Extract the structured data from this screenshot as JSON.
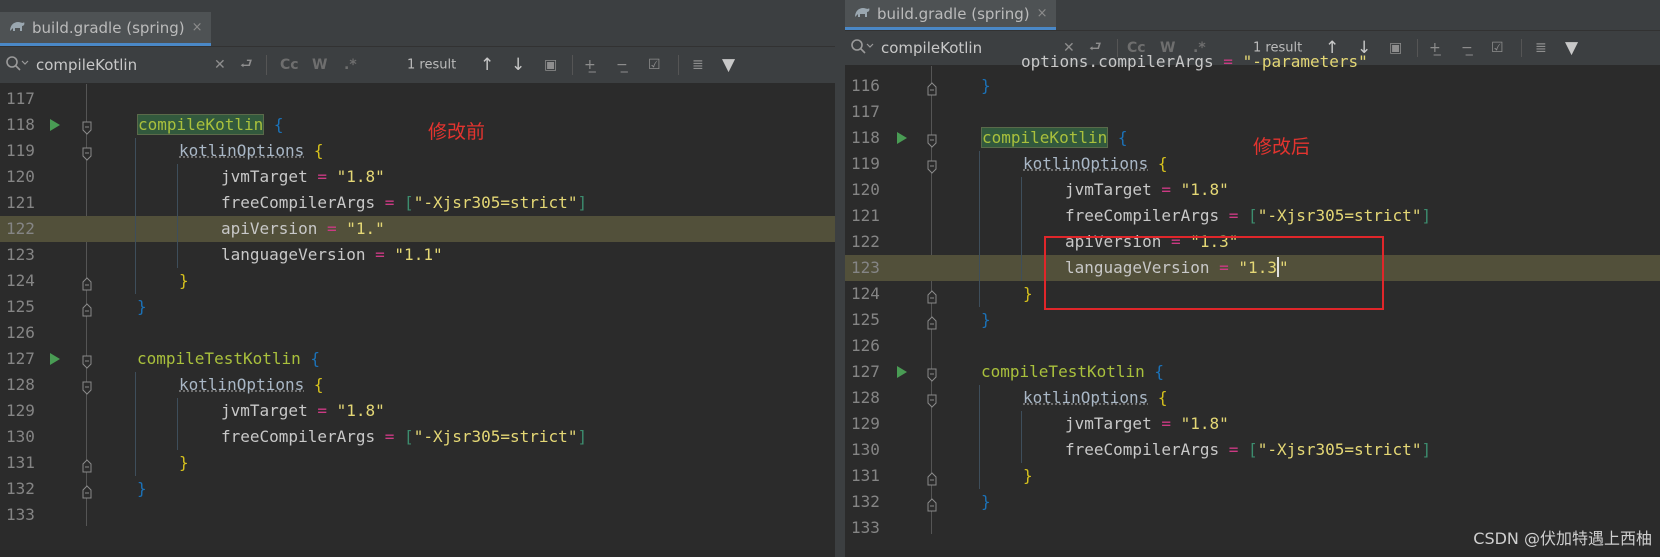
{
  "colors": {
    "editor_bg": "#2b2b2b",
    "toolbar_bg": "#3c3f41",
    "current_line": "#52503a",
    "function": "#a9c03c",
    "string": "#e4d775",
    "operator": "#cc3a84",
    "annotation": "#e3342f"
  },
  "left": {
    "tab": {
      "title": "build.gradle (spring)",
      "close": "×"
    },
    "search": {
      "query": "compileKotlin",
      "clear": "✕",
      "case": "Cc",
      "words": "W",
      "regex": ".*",
      "result": "1 result"
    },
    "annotation": "修改前",
    "lines": [
      {
        "n": "117",
        "c": ""
      },
      {
        "n": "118",
        "c": "compileKotlin"
      },
      {
        "n": "119",
        "c": "kotlinOptions"
      },
      {
        "n": "120",
        "c": "jvmTarget",
        "v": "\"1.8\""
      },
      {
        "n": "121",
        "c": "freeCompilerArgs",
        "v": "\"-Xjsr305=strict\""
      },
      {
        "n": "122",
        "c": "apiVersion",
        "v": "\"1.\""
      },
      {
        "n": "123",
        "c": "languageVersion",
        "v": "\"1.1\""
      },
      {
        "n": "124",
        "c": "}"
      },
      {
        "n": "125",
        "c": "}"
      },
      {
        "n": "126",
        "c": ""
      },
      {
        "n": "127",
        "c": "compileTestKotlin"
      },
      {
        "n": "128",
        "c": "kotlinOptions"
      },
      {
        "n": "129",
        "c": "jvmTarget",
        "v": "\"1.8\""
      },
      {
        "n": "130",
        "c": "freeCompilerArgs",
        "v": "\"-Xjsr305=strict\""
      },
      {
        "n": "131",
        "c": "}"
      },
      {
        "n": "132",
        "c": "}"
      },
      {
        "n": "133",
        "c": ""
      }
    ]
  },
  "right": {
    "tab": {
      "title": "build.gradle (spring)",
      "close": "×"
    },
    "search": {
      "query": "compileKotlin",
      "clear": "✕",
      "case": "Cc",
      "words": "W",
      "regex": ".*",
      "result": "1 result"
    },
    "annotation": "修改后",
    "lines": [
      {
        "n": "116",
        "c": "}"
      },
      {
        "n": "117",
        "c": ""
      },
      {
        "n": "118",
        "c": "compileKotlin"
      },
      {
        "n": "119",
        "c": "kotlinOptions"
      },
      {
        "n": "120",
        "c": "jvmTarget",
        "v": "\"1.8\""
      },
      {
        "n": "121",
        "c": "freeCompilerArgs",
        "v": "\"-Xjsr305=strict\""
      },
      {
        "n": "122",
        "c": "apiVersion",
        "v": "\"1.3\""
      },
      {
        "n": "123",
        "c": "languageVersion",
        "v": "\"1.3"
      },
      {
        "n": "124",
        "c": "}"
      },
      {
        "n": "125",
        "c": "}"
      },
      {
        "n": "126",
        "c": ""
      },
      {
        "n": "127",
        "c": "compileTestKotlin"
      },
      {
        "n": "128",
        "c": "kotlinOptions"
      },
      {
        "n": "129",
        "c": "jvmTarget",
        "v": "\"1.8\""
      },
      {
        "n": "130",
        "c": "freeCompilerArgs",
        "v": "\"-Xjsr305=strict\""
      },
      {
        "n": "131",
        "c": "}"
      },
      {
        "n": "132",
        "c": "}"
      },
      {
        "n": "133",
        "c": ""
      }
    ],
    "line_above_text": "options.compilerArgs",
    "line_above_value": "\"-parameters\""
  },
  "watermark": "CSDN @伏加特遇上西柚"
}
